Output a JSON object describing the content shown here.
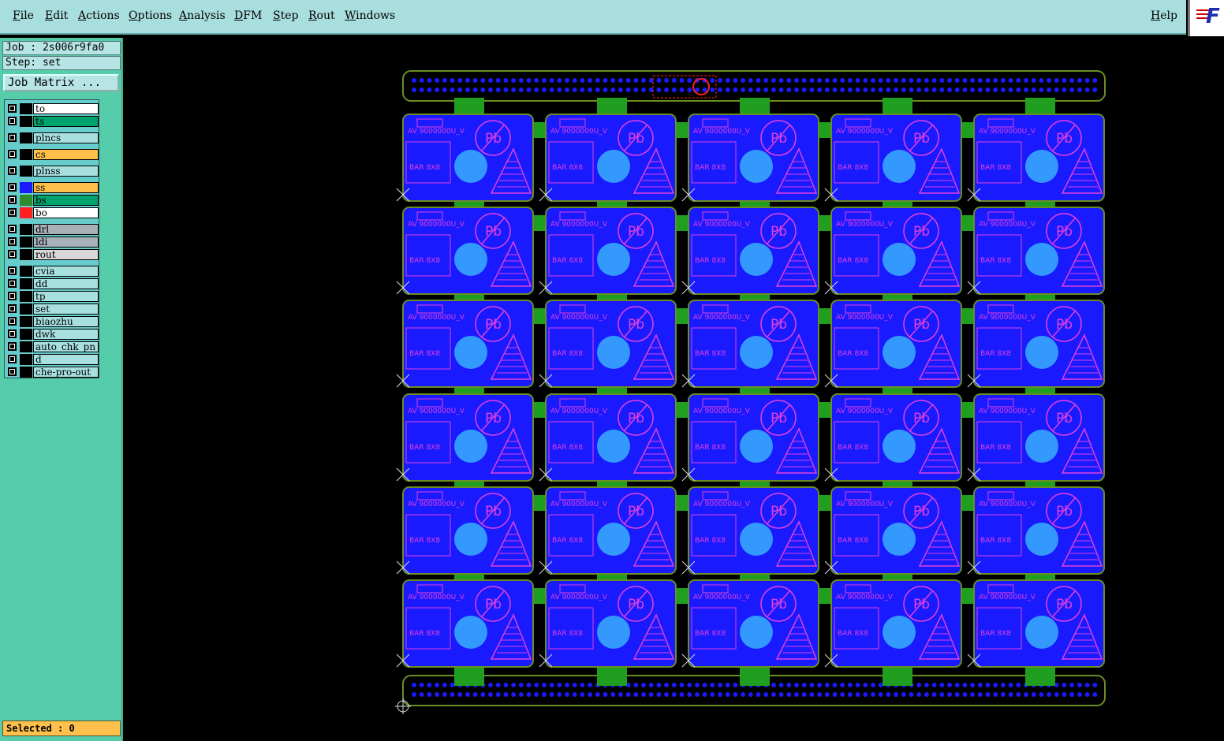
{
  "menubar": {
    "items": [
      "File",
      "Edit",
      "Actions",
      "Options",
      "Analysis",
      "DFM",
      "Step",
      "Rout",
      "Windows"
    ],
    "help": "Help"
  },
  "logo": {
    "text": "F"
  },
  "job": {
    "label": "Job : 2s006r9fa0"
  },
  "step": {
    "label": "Step: set"
  },
  "job_matrix_button": "Job Matrix ...",
  "layers": [
    {
      "name": "to",
      "color": "#ffffff",
      "swatch": "#000000"
    },
    {
      "name": "ts",
      "color": "#00a36c",
      "swatch": "#000000"
    },
    {
      "name": "plncs",
      "color": "#a8e0e0",
      "swatch": "#000000"
    },
    {
      "name": "cs",
      "color": "#ffc04c",
      "swatch": "#000000"
    },
    {
      "name": "plnss",
      "color": "#a8e0e0",
      "swatch": "#000000"
    },
    {
      "name": "ss",
      "color": "#ffc04c",
      "swatch": "#1a1aff"
    },
    {
      "name": "bs",
      "color": "#00a36c",
      "swatch": "#2e8b2e"
    },
    {
      "name": "bo",
      "color": "#ffffff",
      "swatch": "#ff2020"
    },
    {
      "name": "drl",
      "color": "#a8b0b8",
      "swatch": "#000000"
    },
    {
      "name": "ldi",
      "color": "#a8b0b8",
      "swatch": "#000000"
    },
    {
      "name": "rout",
      "color": "#d8d8d8",
      "swatch": "#000000"
    },
    {
      "name": "cvia",
      "color": "#a8e0e0",
      "swatch": "#000000"
    },
    {
      "name": "dd",
      "color": "#a8e0e0",
      "swatch": "#000000"
    },
    {
      "name": "tp",
      "color": "#a8e0e0",
      "swatch": "#000000"
    },
    {
      "name": "set",
      "color": "#a8e0e0",
      "swatch": "#000000"
    },
    {
      "name": "biaozhu",
      "color": "#a8e0e0",
      "swatch": "#000000"
    },
    {
      "name": "dwk",
      "color": "#a8e0e0",
      "swatch": "#000000"
    },
    {
      "name": "auto_chk_pn",
      "color": "#a8e0e0",
      "swatch": "#000000"
    },
    {
      "name": "d",
      "color": "#a8e0e0",
      "swatch": "#000000"
    },
    {
      "name": "che-pro-out",
      "color": "#a8e0e0",
      "swatch": "#000000"
    }
  ],
  "status": {
    "selected": "Selected : 0"
  },
  "board": {
    "rows": 6,
    "cols": 5,
    "cell_text_top": "AV 9000000U_V",
    "cell_text_mid": "BAR 8X8",
    "cell_text_pb": "Pb",
    "colors": {
      "substrate": "#1a1aff",
      "outline": "#6b8e23",
      "tab": "#1f9e1f",
      "circle": "#3399ff",
      "mark": "#e040e0",
      "dots": "#1a1aff",
      "logo": "#ff2020"
    }
  }
}
